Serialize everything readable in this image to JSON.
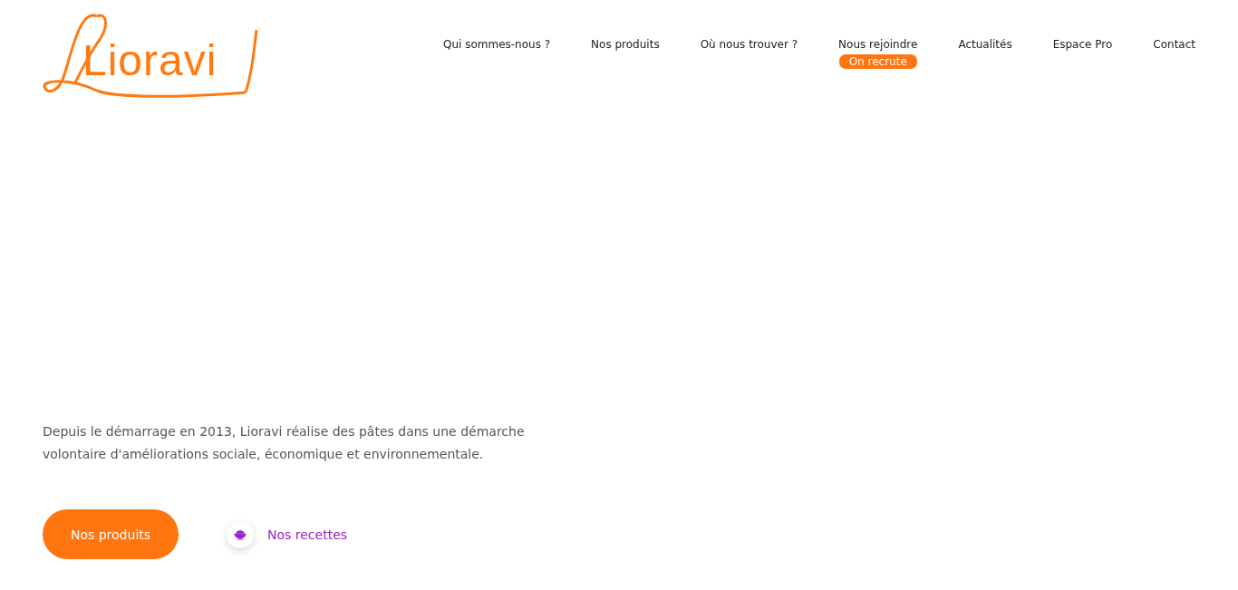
{
  "logo": {
    "text": "Lioravi"
  },
  "nav": [
    {
      "label": "Qui sommes-nous ?"
    },
    {
      "label": "Nos produits"
    },
    {
      "label": "Où nous trouver ?"
    },
    {
      "label": "Nous rejoindre",
      "badge": "On recrute"
    },
    {
      "label": "Actualités"
    },
    {
      "label": "Espace Pro"
    },
    {
      "label": "Contact"
    }
  ],
  "hero": {
    "text": "Depuis le démarrage en 2013, Lioravi réalise des pâtes dans une démarche volontaire d'améliorations sociale, économique et environnementale.",
    "primary_button": "Nos produits",
    "secondary_link": "Nos recettes"
  }
}
